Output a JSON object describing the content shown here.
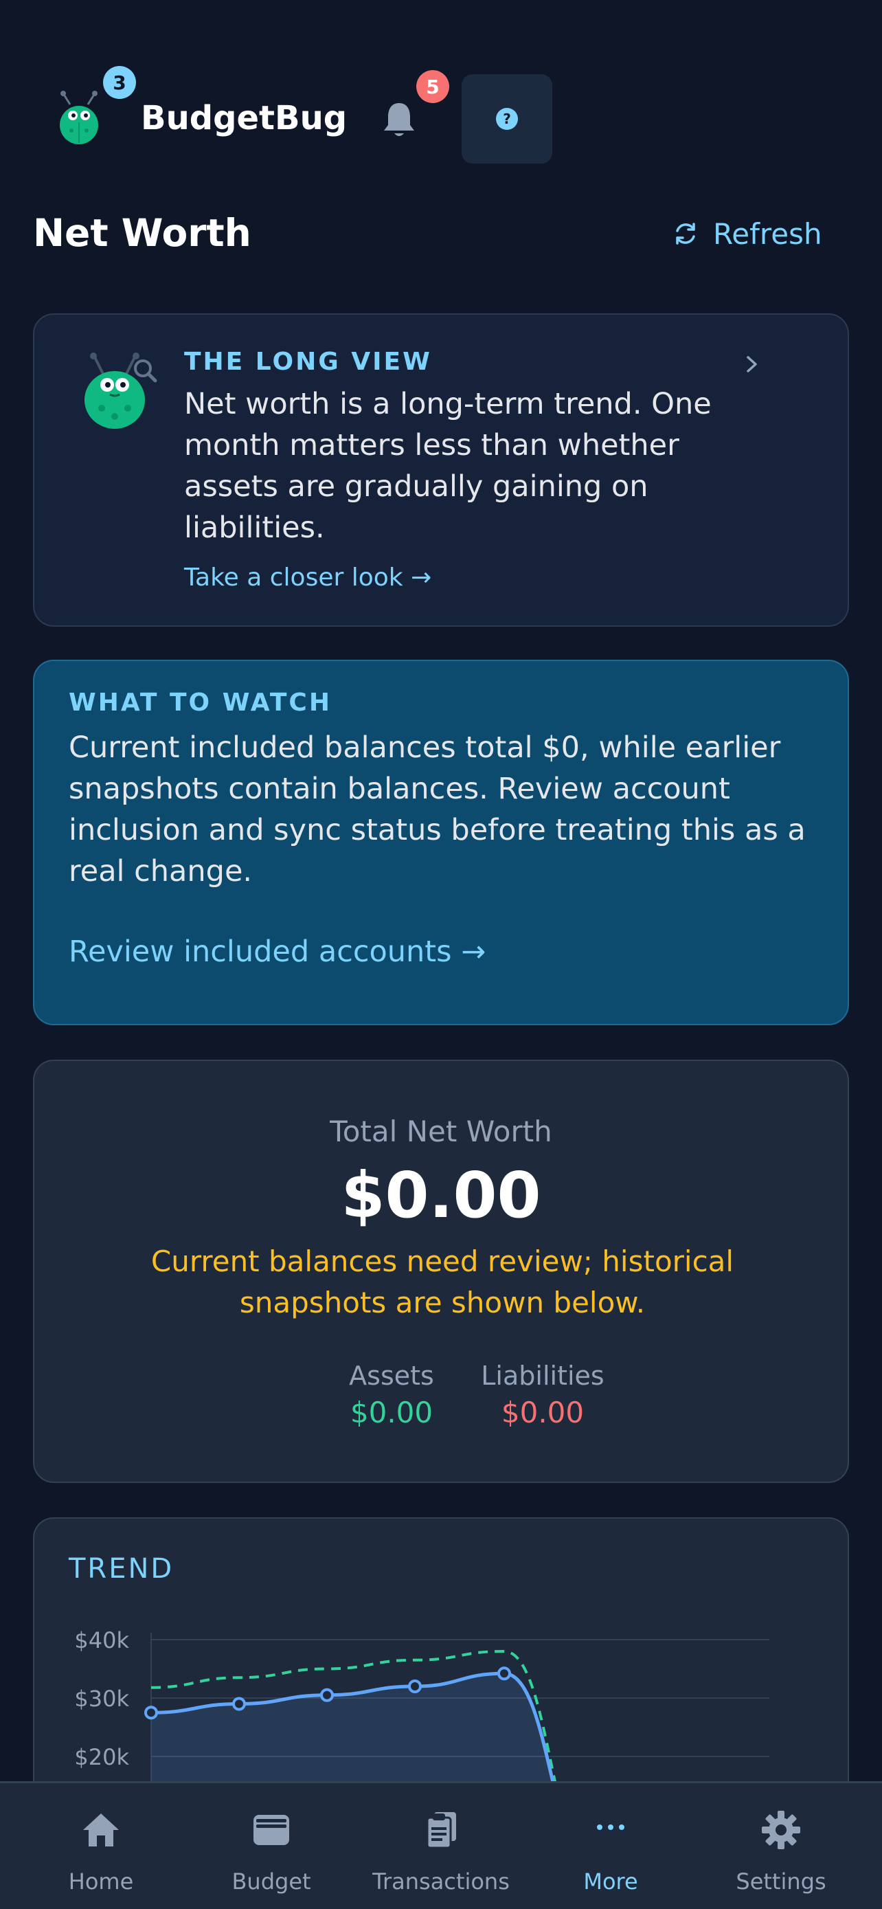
{
  "app": {
    "name": "BudgetBug",
    "logo_badge": "3",
    "notifications_badge": "5"
  },
  "page": {
    "title": "Net Worth",
    "refresh_label": "Refresh"
  },
  "tip": {
    "kicker": "THE LONG VIEW",
    "text": "Net worth is a long-term trend. One month matters less than whether assets are gradually gaining on liabilities.",
    "link": "Take a closer look →"
  },
  "watch": {
    "kicker": "WHAT TO WATCH",
    "text": "Current included balances total $0, while earlier snapshots contain balances. Review account inclusion and sync status before treating this as a real change.",
    "link": "Review included accounts →"
  },
  "summary": {
    "label": "Total Net Worth",
    "value": "$0.00",
    "warning": "Current balances need review; historical snapshots are shown below.",
    "assets_label": "Assets",
    "assets_value": "$0.00",
    "liabilities_label": "Liabilities",
    "liabilities_value": "$0.00"
  },
  "chart_data": {
    "type": "line",
    "title": "TREND",
    "y_ticks": [
      "$40k",
      "$30k",
      "$20k"
    ],
    "ylim": [
      0,
      40000
    ],
    "series": [
      {
        "key": "net",
        "color": "#60a5fa",
        "values": [
          27500,
          29000,
          30500,
          32000,
          34200,
          0
        ]
      },
      {
        "key": "assets",
        "color": "#34d399",
        "dashed": true,
        "values": [
          31800,
          33500,
          35000,
          36500,
          38000,
          0
        ]
      }
    ],
    "grid": true
  },
  "colors": {
    "accent": "#7dd3fc",
    "positive": "#34d399",
    "negative": "#f87171",
    "warning": "#fbbf24"
  },
  "nav": {
    "items": [
      {
        "label": "Home",
        "icon": "home-icon"
      },
      {
        "label": "Budget",
        "icon": "wallet-icon"
      },
      {
        "label": "Transactions",
        "icon": "receipt-icon"
      },
      {
        "label": "More",
        "icon": "more-icon",
        "active": true
      },
      {
        "label": "Settings",
        "icon": "gear-icon"
      }
    ]
  }
}
